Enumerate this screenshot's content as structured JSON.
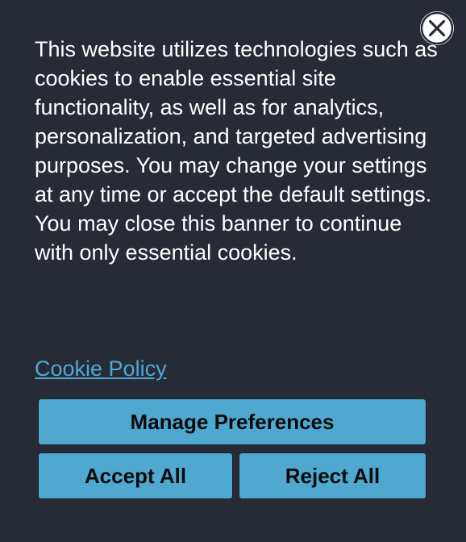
{
  "banner": {
    "message": "This website utilizes technologies such as cookies to enable essential site functionality, as well as for analytics, personalization, and targeted advertising purposes. You may change your settings at any time or accept the default settings. You may close this banner to continue with only essential cookies.",
    "policy_link": "Cookie Policy",
    "close_icon": "close-icon",
    "buttons": {
      "manage": "Manage Preferences",
      "accept": "Accept All",
      "reject": "Reject All"
    }
  },
  "colors": {
    "background": "#262b36",
    "button": "#4ea8d0",
    "link": "#4ea8d8",
    "text": "#ffffff"
  }
}
